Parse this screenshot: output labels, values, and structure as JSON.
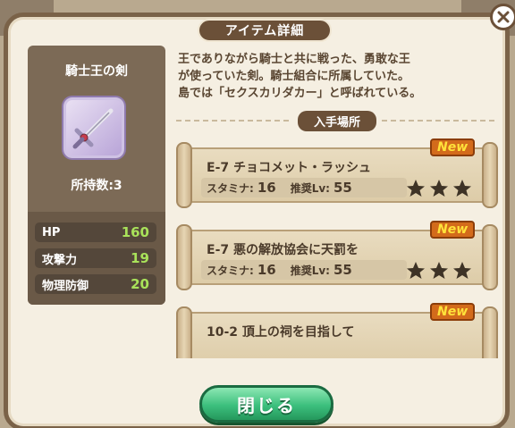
{
  "dialog": {
    "title": "アイテム詳細",
    "close_button_label": "閉じる"
  },
  "item": {
    "name": "騎士王の剣",
    "icon": "sword-icon",
    "owned_count": "所持数:3",
    "stats": [
      {
        "label": "HP",
        "value": "160"
      },
      {
        "label": "攻撃力",
        "value": "19"
      },
      {
        "label": "物理防御",
        "value": "20"
      }
    ],
    "description_lines": [
      "王でありながら騎士と共に戦った、勇敢な王",
      "が使っていた剣。騎士組合に所属していた。",
      "島では「セクスカリダカー」と呼ばれている。"
    ]
  },
  "acquisition": {
    "header": "入手場所",
    "quests": [
      {
        "name": "E-7 チョコメット・ラッシュ",
        "stamina_label": "スタミナ:",
        "stamina": "16",
        "level_label": "推奨Lv:",
        "level": "55",
        "stars": 3,
        "badge": "New"
      },
      {
        "name": "E-7 悪の解放協会に天罰を",
        "stamina_label": "スタミナ:",
        "stamina": "16",
        "level_label": "推奨Lv:",
        "level": "55",
        "stars": 3,
        "badge": "New"
      },
      {
        "name": "10-2 頂上の祠を目指して",
        "badge": "New"
      }
    ]
  },
  "colors": {
    "stat_value": "#a9e25a",
    "button_green": "#3cbf7d",
    "frame_brown": "#7a6248"
  }
}
